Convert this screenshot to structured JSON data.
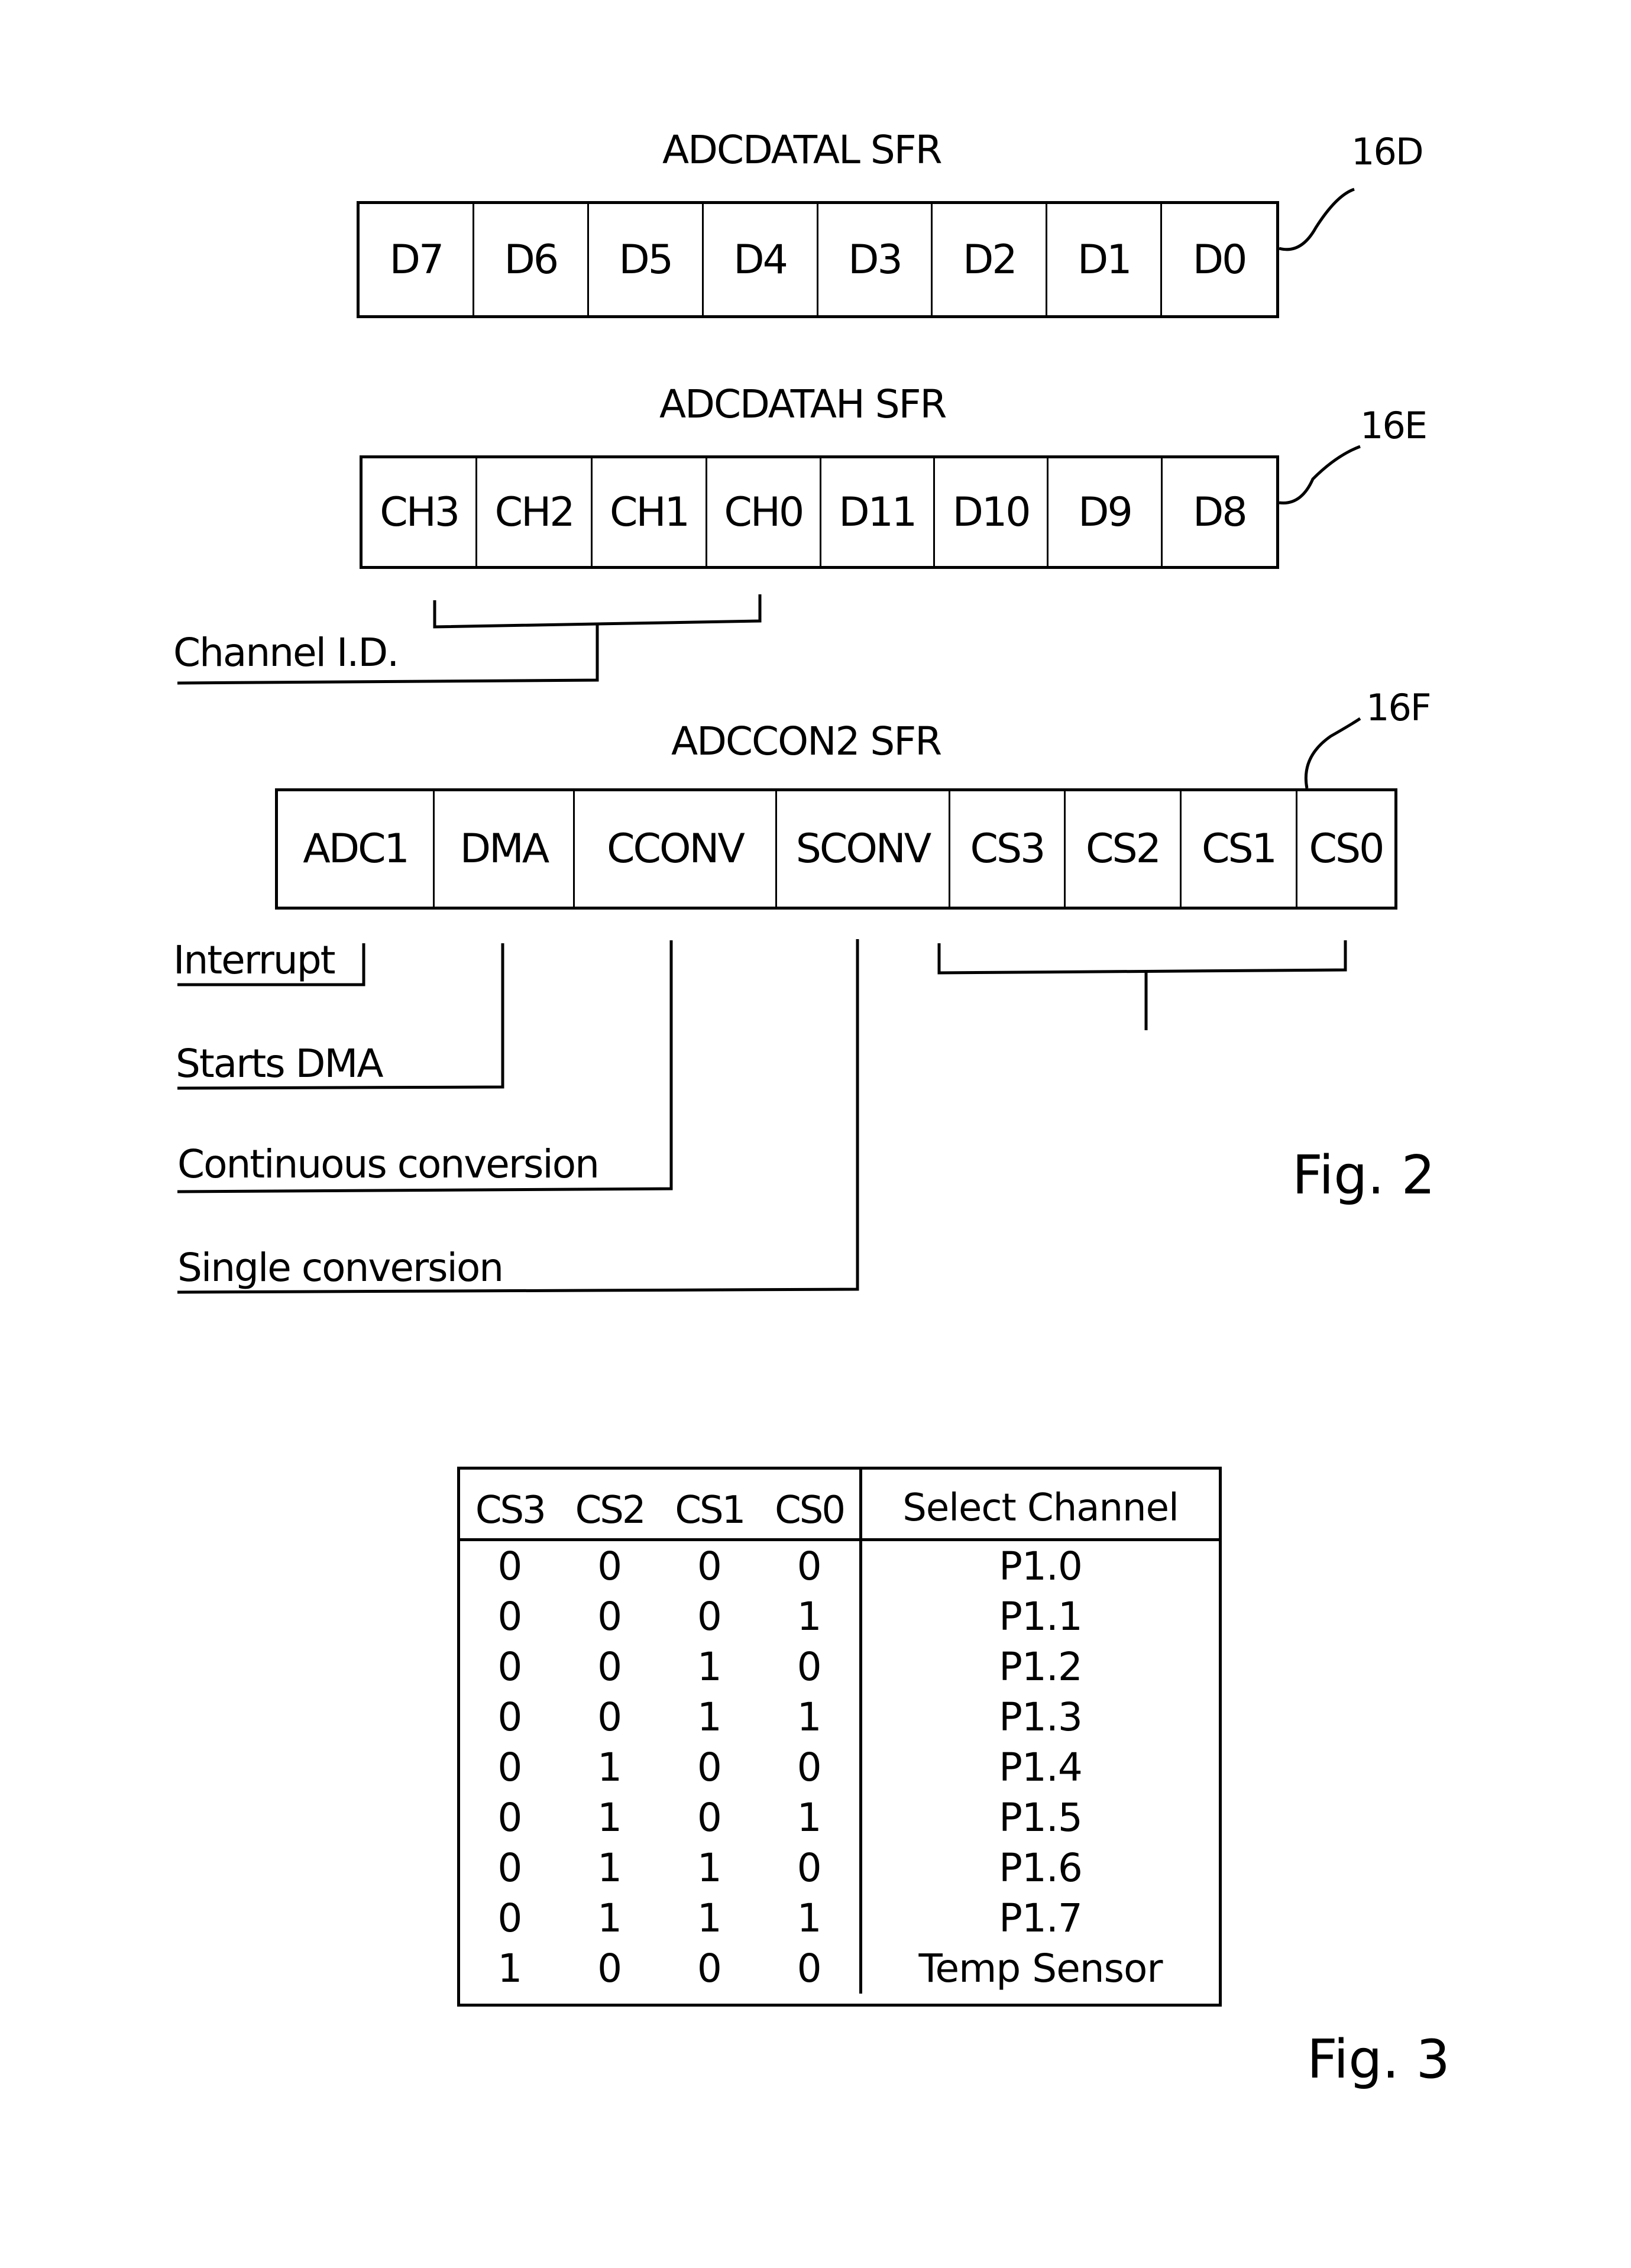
{
  "fig2": {
    "label": "Fig. 2",
    "registers": [
      {
        "title": "ADCDATAL SFR",
        "ref": "16D",
        "bits": [
          "D7",
          "D6",
          "D5",
          "D4",
          "D3",
          "D2",
          "D1",
          "D0"
        ]
      },
      {
        "title": "ADCDATAH SFR",
        "ref": "16E",
        "bits": [
          "CH3",
          "CH2",
          "CH1",
          "CH0",
          "D11",
          "D10",
          "D9",
          "D8"
        ],
        "annotation": "Channel I.D."
      },
      {
        "title": "ADCCON2 SFR",
        "ref": "16F",
        "bits": [
          "ADC1",
          "DMA",
          "CCONV",
          "SCONV",
          "CS3",
          "CS2",
          "CS1",
          "CS0"
        ],
        "annotations": [
          "Interrupt",
          "Starts DMA",
          "Continuous conversion",
          "Single conversion"
        ]
      }
    ]
  },
  "fig3": {
    "label": "Fig. 3",
    "table": {
      "headers": [
        "CS3",
        "CS2",
        "CS1",
        "CS0",
        "Select Channel"
      ],
      "rows": [
        {
          "bits": [
            "0",
            "0",
            "0",
            "0"
          ],
          "channel": "P1.0"
        },
        {
          "bits": [
            "0",
            "0",
            "0",
            "1"
          ],
          "channel": "P1.1"
        },
        {
          "bits": [
            "0",
            "0",
            "1",
            "0"
          ],
          "channel": "P1.2"
        },
        {
          "bits": [
            "0",
            "0",
            "1",
            "1"
          ],
          "channel": "P1.3"
        },
        {
          "bits": [
            "0",
            "1",
            "0",
            "0"
          ],
          "channel": "P1.4"
        },
        {
          "bits": [
            "0",
            "1",
            "0",
            "1"
          ],
          "channel": "P1.5"
        },
        {
          "bits": [
            "0",
            "1",
            "1",
            "0"
          ],
          "channel": "P1.6"
        },
        {
          "bits": [
            "0",
            "1",
            "1",
            "1"
          ],
          "channel": "P1.7"
        },
        {
          "bits": [
            "1",
            "0",
            "0",
            "0"
          ],
          "channel": "Temp Sensor"
        }
      ]
    }
  }
}
